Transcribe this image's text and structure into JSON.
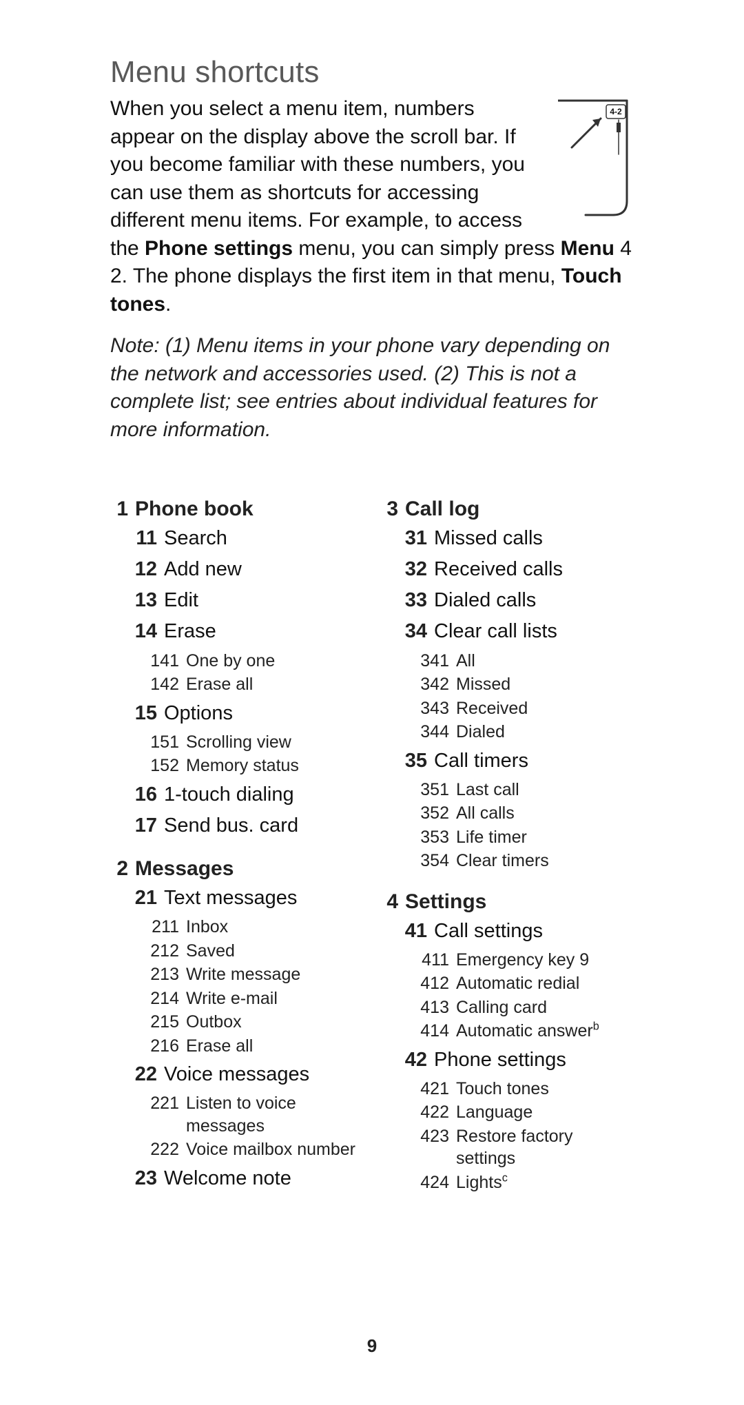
{
  "title": "Menu shortcuts",
  "intro": {
    "p1": "When you select a menu item, numbers appear on the display above the scroll bar. If you become familiar with these numbers, you can use them as shortcuts for accessing different menu items. For example, to access the ",
    "b1": "Phone settings",
    "p2": " menu, you can simply press ",
    "b2": "Menu",
    "p3": " 4 2. The phone displays the first item in that menu, ",
    "b3": "Touch tones",
    "p4": "."
  },
  "display_label": "4-2",
  "note": "Note:  (1) Menu items in your phone vary depending on the network and accessories used. (2) This is not a complete list; see entries about individual features for more information.",
  "page_number": "9",
  "left_sections": [
    {
      "num": "1",
      "label": "Phone book",
      "items": [
        {
          "num": "11",
          "label": "Search"
        },
        {
          "num": "12",
          "label": "Add new"
        },
        {
          "num": "13",
          "label": "Edit"
        },
        {
          "num": "14",
          "label": "Erase",
          "sub": [
            {
              "num": "141",
              "label": "One by one"
            },
            {
              "num": "142",
              "label": "Erase all"
            }
          ]
        },
        {
          "num": "15",
          "label": "Options",
          "sub": [
            {
              "num": "151",
              "label": "Scrolling view"
            },
            {
              "num": "152",
              "label": "Memory status"
            }
          ]
        },
        {
          "num": "16",
          "label": "1-touch dialing"
        },
        {
          "num": "17",
          "label": "Send bus. card"
        }
      ]
    },
    {
      "num": "2",
      "label": "Messages",
      "items": [
        {
          "num": "21",
          "label": "Text messages",
          "sub": [
            {
              "num": "211",
              "label": "Inbox"
            },
            {
              "num": "212",
              "label": "Saved"
            },
            {
              "num": "213",
              "label": "Write message"
            },
            {
              "num": "214",
              "label": "Write e-mail"
            },
            {
              "num": "215",
              "label": "Outbox"
            },
            {
              "num": "216",
              "label": "Erase all"
            }
          ]
        },
        {
          "num": "22",
          "label": "Voice messages",
          "sub": [
            {
              "num": "221",
              "label": "Listen to voice messages"
            },
            {
              "num": "222",
              "label": "Voice mailbox number"
            }
          ]
        },
        {
          "num": "23",
          "label": "Welcome note"
        }
      ]
    }
  ],
  "right_sections": [
    {
      "num": "3",
      "label": "Call log",
      "items": [
        {
          "num": "31",
          "label": "Missed calls"
        },
        {
          "num": "32",
          "label": "Received calls"
        },
        {
          "num": "33",
          "label": "Dialed calls"
        },
        {
          "num": "34",
          "label": "Clear call lists",
          "sub": [
            {
              "num": "341",
              "label": "All"
            },
            {
              "num": "342",
              "label": "Missed"
            },
            {
              "num": "343",
              "label": "Received"
            },
            {
              "num": "344",
              "label": "Dialed"
            }
          ]
        },
        {
          "num": "35",
          "label": "Call timers",
          "sub": [
            {
              "num": "351",
              "label": "Last call"
            },
            {
              "num": "352",
              "label": "All calls"
            },
            {
              "num": "353",
              "label": "Life timer"
            },
            {
              "num": "354",
              "label": "Clear timers"
            }
          ]
        }
      ]
    },
    {
      "num": "4",
      "label": "Settings",
      "items": [
        {
          "num": "41",
          "label": "Call settings",
          "sub": [
            {
              "num": "411",
              "label": "Emergency key 9"
            },
            {
              "num": "412",
              "label": "Automatic redial"
            },
            {
              "num": "413",
              "label": "Calling card"
            },
            {
              "num": "414",
              "label": "Automatic answer",
              "sup": "b"
            }
          ]
        },
        {
          "num": "42",
          "label": "Phone settings",
          "sub": [
            {
              "num": "421",
              "label": "Touch tones"
            },
            {
              "num": "422",
              "label": "Language"
            },
            {
              "num": "423",
              "label": "Restore factory settings"
            },
            {
              "num": "424",
              "label": "Lights",
              "sup": "c"
            }
          ]
        }
      ]
    }
  ]
}
